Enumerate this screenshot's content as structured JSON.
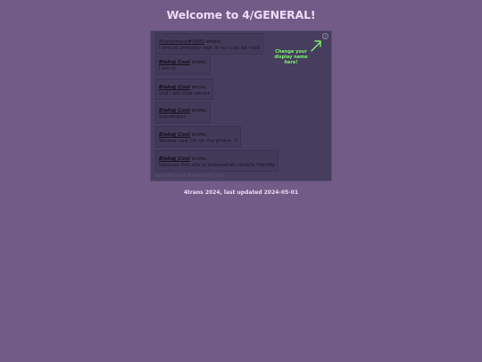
{
  "page": {
    "title": "Welcome to 4/GENERAL!",
    "updated": "4trans 2024, last updated 2024-05-01"
  },
  "chat": {
    "close_label": "x",
    "wrote_label": "wrote,",
    "hint": "Change your display name here!",
    "footer": "Send Message Powered by Doc",
    "messages": [
      {
        "author": "Anonymous#5693",
        "text": "I should probably sign in so I can be mod"
      },
      {
        "author": "Blahaj Cool",
        "text": "I am in"
      },
      {
        "author": "Blahaj Cool",
        "text": "and I am chat owner"
      },
      {
        "author": "Blahaj Cool",
        "text": "wunderbar"
      },
      {
        "author": "Blahaj Cool",
        "text": "Wowee now I'm on my phone :3"
      },
      {
        "author": "Blahaj Cool",
        "text": "because this site is (somewhat) mobile friendly"
      }
    ]
  },
  "colors": {
    "background": "#735b88",
    "chat_panel": "#463d5f",
    "hint": "#7cf26a"
  }
}
